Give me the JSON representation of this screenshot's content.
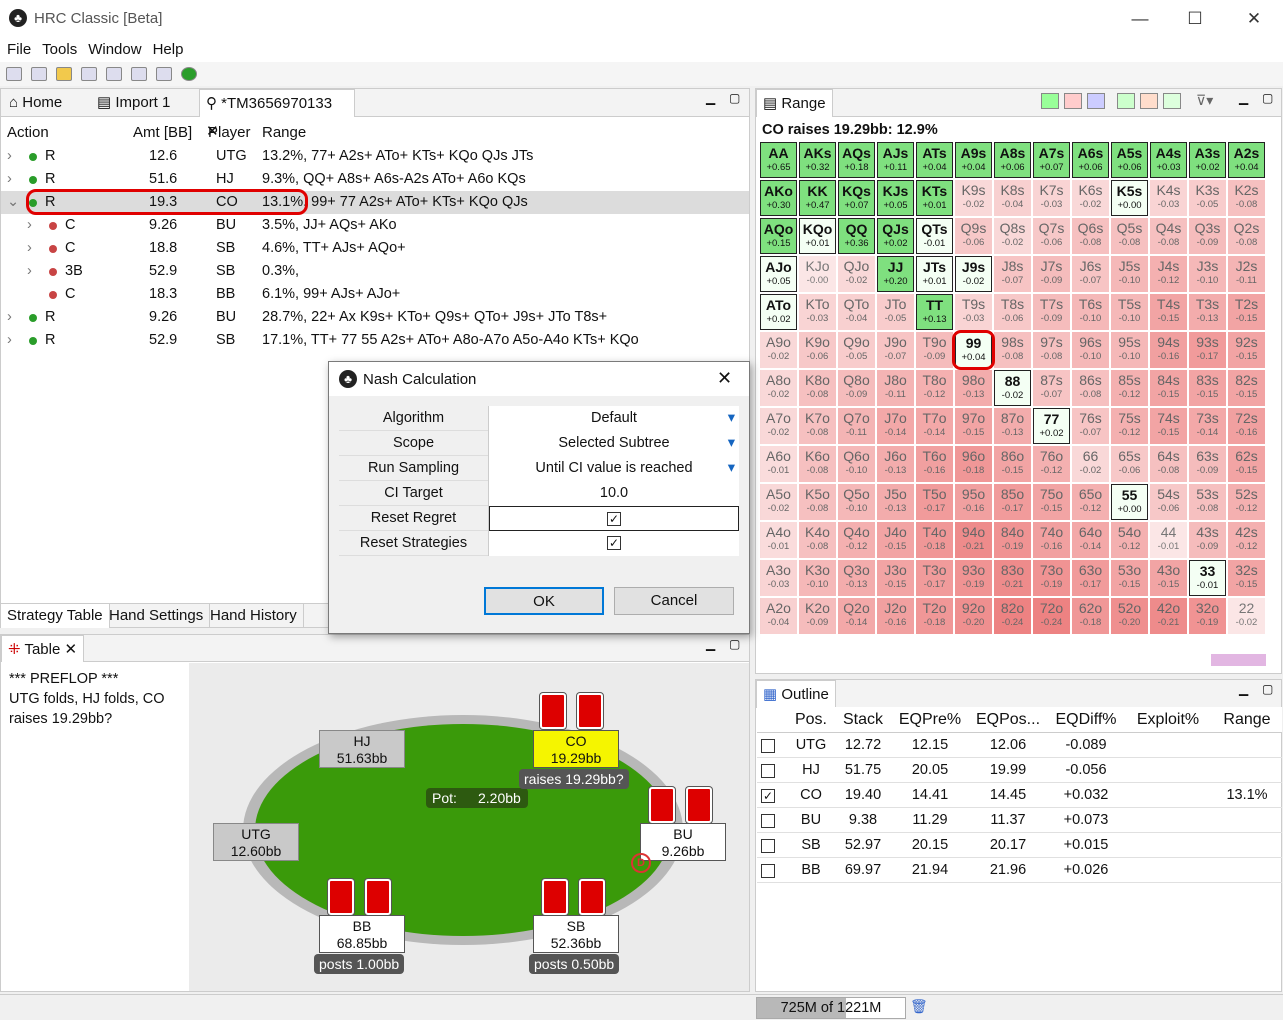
{
  "window": {
    "title": "HRC Classic [Beta]",
    "min": "—",
    "max": "☐",
    "close": "✕"
  },
  "menu": [
    "File",
    "Tools",
    "Window",
    "Help"
  ],
  "tabs": {
    "home": "Home",
    "import": "Import 1",
    "tree": "*TM3656970133"
  },
  "tree": {
    "headers": {
      "action": "Action",
      "amt": "Amt [BB]",
      "player": "Player",
      "range": "Range"
    },
    "rows": [
      {
        "exp": "›",
        "dot": "#2a9d2a",
        "action": "R",
        "amt": "12.6",
        "player": "UTG",
        "range": "13.2%, 77+ A2s+ ATo+ KTs+ KQo QJs JTs",
        "indent": 0,
        "sel": false
      },
      {
        "exp": "›",
        "dot": "#2a9d2a",
        "action": "R",
        "amt": "51.6",
        "player": "HJ",
        "range": "9.3%, QQ+ A8s+ A6s-A2s ATo+ A6o KQs",
        "indent": 0,
        "sel": false
      },
      {
        "exp": "⌄",
        "dot": "#2a9d2a",
        "action": "R",
        "amt": "19.3",
        "player": "CO",
        "range": "13.1%, 99+ 77 A2s+ ATo+ KTs+ KQo QJs",
        "indent": 0,
        "sel": true
      },
      {
        "exp": "›",
        "dot": "#c84444",
        "action": "C",
        "amt": "9.26",
        "player": "BU",
        "range": "3.5%, JJ+ AQs+ AKo",
        "indent": 1,
        "sel": false
      },
      {
        "exp": "›",
        "dot": "#c84444",
        "action": "C",
        "amt": "18.8",
        "player": "SB",
        "range": "4.6%, TT+ AJs+ AQo+",
        "indent": 1,
        "sel": false
      },
      {
        "exp": "›",
        "dot": "#c84444",
        "action": "3B",
        "amt": "52.9",
        "player": "SB",
        "range": "0.3%,",
        "indent": 1,
        "sel": false
      },
      {
        "exp": "",
        "dot": "#c84444",
        "action": "C",
        "amt": "18.3",
        "player": "BB",
        "range": "6.1%, 99+ AJs+ AJo+",
        "indent": 1,
        "sel": false
      },
      {
        "exp": "›",
        "dot": "#2a9d2a",
        "action": "R",
        "amt": "9.26",
        "player": "BU",
        "range": "28.7%, 22+ Ax K9s+ KTo+ Q9s+ QTo+ J9s+ JTo T8s+",
        "indent": 0,
        "sel": false
      },
      {
        "exp": "›",
        "dot": "#2a9d2a",
        "action": "R",
        "amt": "52.9",
        "player": "SB",
        "range": "17.1%, TT+ 77 55 A2s+ ATo+ A8o-A7o A5o-A4o KTs+ KQo",
        "indent": 0,
        "sel": false
      }
    ]
  },
  "bottom_tabs": [
    "Strategy Table",
    "Hand Settings",
    "Hand History"
  ],
  "table_panel": {
    "title": "Table",
    "log_line1": "*** PREFLOP ***",
    "log_line2": "UTG folds, HJ folds, CO",
    "log_line3": "raises 19.29bb?"
  },
  "seats": {
    "hj": {
      "name": "HJ",
      "stack": "51.63bb"
    },
    "co": {
      "name": "CO",
      "stack": "19.29bb",
      "action": "raises 19.29bb?"
    },
    "utg": {
      "name": "UTG",
      "stack": "12.60bb"
    },
    "bu": {
      "name": "BU",
      "stack": "9.26bb"
    },
    "bb": {
      "name": "BB",
      "stack": "68.85bb",
      "action": "posts 1.00bb"
    },
    "sb": {
      "name": "SB",
      "stack": "52.36bb",
      "action": "posts 0.50bb"
    }
  },
  "pot": {
    "label": "Pot:",
    "value": "2.20bb"
  },
  "dialog": {
    "title": "Nash Calculation",
    "fields": [
      {
        "label": "Algorithm",
        "value": "Default",
        "dropdown": true
      },
      {
        "label": "Scope",
        "value": "Selected Subtree",
        "dropdown": true
      },
      {
        "label": "Run Sampling",
        "value": "Until CI value is reached",
        "dropdown": true
      },
      {
        "label": "CI Target",
        "value": "10.0",
        "dropdown": false
      },
      {
        "label": "Reset Regret",
        "value": "✓",
        "checkbox": true
      },
      {
        "label": "Reset Strategies",
        "value": "✓",
        "checkbox": true
      }
    ],
    "ok": "OK",
    "cancel": "Cancel"
  },
  "range_panel": {
    "title": "Range",
    "summary": "CO raises 19.29bb: 12.9%"
  },
  "range_grid": [
    [
      [
        "AA",
        "+0.65",
        1
      ],
      [
        "AKs",
        "+0.32",
        1
      ],
      [
        "AQs",
        "+0.18",
        1
      ],
      [
        "AJs",
        "+0.11",
        1
      ],
      [
        "ATs",
        "+0.04",
        1
      ],
      [
        "A9s",
        "+0.04",
        1
      ],
      [
        "A8s",
        "+0.06",
        1
      ],
      [
        "A7s",
        "+0.07",
        1
      ],
      [
        "A6s",
        "+0.06",
        1
      ],
      [
        "A5s",
        "+0.06",
        1
      ],
      [
        "A4s",
        "+0.03",
        1
      ],
      [
        "A3s",
        "+0.02",
        1
      ],
      [
        "A2s",
        "+0.04",
        1
      ]
    ],
    [
      [
        "AKo",
        "+0.30",
        1
      ],
      [
        "KK",
        "+0.47",
        1
      ],
      [
        "KQs",
        "+0.07",
        1
      ],
      [
        "KJs",
        "+0.05",
        1
      ],
      [
        "KTs",
        "+0.01",
        1
      ],
      [
        "K9s",
        "-0.02",
        0
      ],
      [
        "K8s",
        "-0.04",
        0
      ],
      [
        "K7s",
        "-0.03",
        0
      ],
      [
        "K6s",
        "-0.02",
        0
      ],
      [
        "K5s",
        "+0.00",
        2
      ],
      [
        "K4s",
        "-0.03",
        0
      ],
      [
        "K3s",
        "-0.05",
        0
      ],
      [
        "K2s",
        "-0.08",
        0
      ]
    ],
    [
      [
        "AQo",
        "+0.15",
        1
      ],
      [
        "KQo",
        "+0.01",
        2
      ],
      [
        "QQ",
        "+0.36",
        1
      ],
      [
        "QJs",
        "+0.02",
        1
      ],
      [
        "QTs",
        "-0.01",
        2
      ],
      [
        "Q9s",
        "-0.06",
        0
      ],
      [
        "Q8s",
        "-0.02",
        0
      ],
      [
        "Q7s",
        "-0.06",
        0
      ],
      [
        "Q6s",
        "-0.08",
        0
      ],
      [
        "Q5s",
        "-0.08",
        0
      ],
      [
        "Q4s",
        "-0.08",
        0
      ],
      [
        "Q3s",
        "-0.09",
        0
      ],
      [
        "Q2s",
        "-0.08",
        0
      ]
    ],
    [
      [
        "AJo",
        "+0.05",
        2
      ],
      [
        "KJo",
        "-0.00",
        3
      ],
      [
        "QJo",
        "-0.02",
        0
      ],
      [
        "JJ",
        "+0.20",
        1
      ],
      [
        "JTs",
        "+0.01",
        2
      ],
      [
        "J9s",
        "-0.02",
        2
      ],
      [
        "J8s",
        "-0.07",
        0
      ],
      [
        "J7s",
        "-0.09",
        0
      ],
      [
        "J6s",
        "-0.07",
        0
      ],
      [
        "J5s",
        "-0.10",
        0
      ],
      [
        "J4s",
        "-0.12",
        0
      ],
      [
        "J3s",
        "-0.10",
        0
      ],
      [
        "J2s",
        "-0.11",
        0
      ]
    ],
    [
      [
        "ATo",
        "+0.02",
        2
      ],
      [
        "KTo",
        "-0.03",
        0
      ],
      [
        "QTo",
        "-0.04",
        0
      ],
      [
        "JTo",
        "-0.05",
        0
      ],
      [
        "TT",
        "+0.13",
        1
      ],
      [
        "T9s",
        "-0.03",
        0
      ],
      [
        "T8s",
        "-0.06",
        0
      ],
      [
        "T7s",
        "-0.09",
        0
      ],
      [
        "T6s",
        "-0.10",
        0
      ],
      [
        "T5s",
        "-0.10",
        0
      ],
      [
        "T4s",
        "-0.15",
        0
      ],
      [
        "T3s",
        "-0.13",
        0
      ],
      [
        "T2s",
        "-0.15",
        0
      ]
    ],
    [
      [
        "A9o",
        "-0.02",
        0
      ],
      [
        "K9o",
        "-0.06",
        0
      ],
      [
        "Q9o",
        "-0.05",
        0
      ],
      [
        "J9o",
        "-0.07",
        0
      ],
      [
        "T9o",
        "-0.09",
        0
      ],
      [
        "99",
        "+0.04",
        2
      ],
      [
        "98s",
        "-0.08",
        0
      ],
      [
        "97s",
        "-0.08",
        0
      ],
      [
        "96s",
        "-0.10",
        0
      ],
      [
        "95s",
        "-0.10",
        0
      ],
      [
        "94s",
        "-0.16",
        0
      ],
      [
        "93s",
        "-0.17",
        0
      ],
      [
        "92s",
        "-0.15",
        0
      ]
    ],
    [
      [
        "A8o",
        "-0.02",
        0
      ],
      [
        "K8o",
        "-0.08",
        0
      ],
      [
        "Q8o",
        "-0.09",
        0
      ],
      [
        "J8o",
        "-0.11",
        0
      ],
      [
        "T8o",
        "-0.12",
        0
      ],
      [
        "98o",
        "-0.13",
        0
      ],
      [
        "88",
        "-0.02",
        2
      ],
      [
        "87s",
        "-0.07",
        0
      ],
      [
        "86s",
        "-0.08",
        0
      ],
      [
        "85s",
        "-0.12",
        0
      ],
      [
        "84s",
        "-0.15",
        0
      ],
      [
        "83s",
        "-0.15",
        0
      ],
      [
        "82s",
        "-0.15",
        0
      ]
    ],
    [
      [
        "A7o",
        "-0.02",
        0
      ],
      [
        "K7o",
        "-0.08",
        0
      ],
      [
        "Q7o",
        "-0.11",
        0
      ],
      [
        "J7o",
        "-0.14",
        0
      ],
      [
        "T7o",
        "-0.14",
        0
      ],
      [
        "97o",
        "-0.15",
        0
      ],
      [
        "87o",
        "-0.13",
        0
      ],
      [
        "77",
        "+0.02",
        2
      ],
      [
        "76s",
        "-0.07",
        0
      ],
      [
        "75s",
        "-0.12",
        0
      ],
      [
        "74s",
        "-0.15",
        0
      ],
      [
        "73s",
        "-0.14",
        0
      ],
      [
        "72s",
        "-0.16",
        0
      ]
    ],
    [
      [
        "A6o",
        "-0.01",
        0
      ],
      [
        "K6o",
        "-0.08",
        0
      ],
      [
        "Q6o",
        "-0.10",
        0
      ],
      [
        "J6o",
        "-0.13",
        0
      ],
      [
        "T6o",
        "-0.16",
        0
      ],
      [
        "96o",
        "-0.18",
        0
      ],
      [
        "86o",
        "-0.15",
        0
      ],
      [
        "76o",
        "-0.12",
        0
      ],
      [
        "66",
        "-0.02",
        0
      ],
      [
        "65s",
        "-0.06",
        0
      ],
      [
        "64s",
        "-0.08",
        0
      ],
      [
        "63s",
        "-0.09",
        0
      ],
      [
        "62s",
        "-0.15",
        0
      ]
    ],
    [
      [
        "A5o",
        "-0.02",
        0
      ],
      [
        "K5o",
        "-0.08",
        0
      ],
      [
        "Q5o",
        "-0.10",
        0
      ],
      [
        "J5o",
        "-0.13",
        0
      ],
      [
        "T5o",
        "-0.17",
        0
      ],
      [
        "95o",
        "-0.16",
        0
      ],
      [
        "85o",
        "-0.17",
        0
      ],
      [
        "75o",
        "-0.15",
        0
      ],
      [
        "65o",
        "-0.12",
        0
      ],
      [
        "55",
        "+0.00",
        2
      ],
      [
        "54s",
        "-0.06",
        0
      ],
      [
        "53s",
        "-0.08",
        0
      ],
      [
        "52s",
        "-0.12",
        0
      ]
    ],
    [
      [
        "A4o",
        "-0.01",
        0
      ],
      [
        "K4o",
        "-0.08",
        0
      ],
      [
        "Q4o",
        "-0.12",
        0
      ],
      [
        "J4o",
        "-0.15",
        0
      ],
      [
        "T4o",
        "-0.18",
        0
      ],
      [
        "94o",
        "-0.21",
        0
      ],
      [
        "84o",
        "-0.19",
        0
      ],
      [
        "74o",
        "-0.16",
        0
      ],
      [
        "64o",
        "-0.14",
        0
      ],
      [
        "54o",
        "-0.12",
        0
      ],
      [
        "44",
        "-0.01",
        3
      ],
      [
        "43s",
        "-0.09",
        0
      ],
      [
        "42s",
        "-0.12",
        0
      ]
    ],
    [
      [
        "A3o",
        "-0.03",
        0
      ],
      [
        "K3o",
        "-0.10",
        0
      ],
      [
        "Q3o",
        "-0.13",
        0
      ],
      [
        "J3o",
        "-0.15",
        0
      ],
      [
        "T3o",
        "-0.17",
        0
      ],
      [
        "93o",
        "-0.19",
        0
      ],
      [
        "83o",
        "-0.21",
        0
      ],
      [
        "73o",
        "-0.19",
        0
      ],
      [
        "63o",
        "-0.17",
        0
      ],
      [
        "53o",
        "-0.15",
        0
      ],
      [
        "43o",
        "-0.15",
        0
      ],
      [
        "33",
        "-0.01",
        2
      ],
      [
        "32s",
        "-0.15",
        0
      ]
    ],
    [
      [
        "A2o",
        "-0.04",
        0
      ],
      [
        "K2o",
        "-0.09",
        0
      ],
      [
        "Q2o",
        "-0.14",
        0
      ],
      [
        "J2o",
        "-0.16",
        0
      ],
      [
        "T2o",
        "-0.18",
        0
      ],
      [
        "92o",
        "-0.20",
        0
      ],
      [
        "82o",
        "-0.24",
        0
      ],
      [
        "72o",
        "-0.24",
        0
      ],
      [
        "62o",
        "-0.18",
        0
      ],
      [
        "52o",
        "-0.20",
        0
      ],
      [
        "42o",
        "-0.21",
        0
      ],
      [
        "32o",
        "-0.19",
        0
      ],
      [
        "22",
        "-0.02",
        3
      ]
    ]
  ],
  "outline": {
    "title": "Outline",
    "headers": [
      "Pos.",
      "Stack",
      "EQPre%",
      "EQPos...",
      "EQDiff%",
      "Exploit%",
      "Range"
    ],
    "rows": [
      {
        "check": "",
        "pos": "UTG",
        "stack": "12.72",
        "pre": "12.15",
        "post": "12.06",
        "diff": "-0.089",
        "exploit": "",
        "range": ""
      },
      {
        "check": "",
        "pos": "HJ",
        "stack": "51.75",
        "pre": "20.05",
        "post": "19.99",
        "diff": "-0.056",
        "exploit": "",
        "range": ""
      },
      {
        "check": "✓",
        "pos": "CO",
        "stack": "19.40",
        "pre": "14.41",
        "post": "14.45",
        "diff": "+0.032",
        "exploit": "",
        "range": "13.1%"
      },
      {
        "check": "",
        "pos": "BU",
        "stack": "9.38",
        "pre": "11.29",
        "post": "11.37",
        "diff": "+0.073",
        "exploit": "",
        "range": ""
      },
      {
        "check": "",
        "pos": "SB",
        "stack": "52.97",
        "pre": "20.15",
        "post": "20.17",
        "diff": "+0.015",
        "exploit": "",
        "range": ""
      },
      {
        "check": "",
        "pos": "BB",
        "stack": "69.97",
        "pre": "21.94",
        "post": "21.96",
        "diff": "+0.026",
        "exploit": "",
        "range": ""
      }
    ]
  },
  "status": {
    "memory": "725M of 1221M"
  },
  "colors": {
    "in_range": "#7fe07f",
    "out_range": "#f5b5b5",
    "marginal": "#fbe6e6",
    "table_felt": "#3a9a0a",
    "co_highlight": "#f5f500",
    "annotation": "#e00000"
  }
}
